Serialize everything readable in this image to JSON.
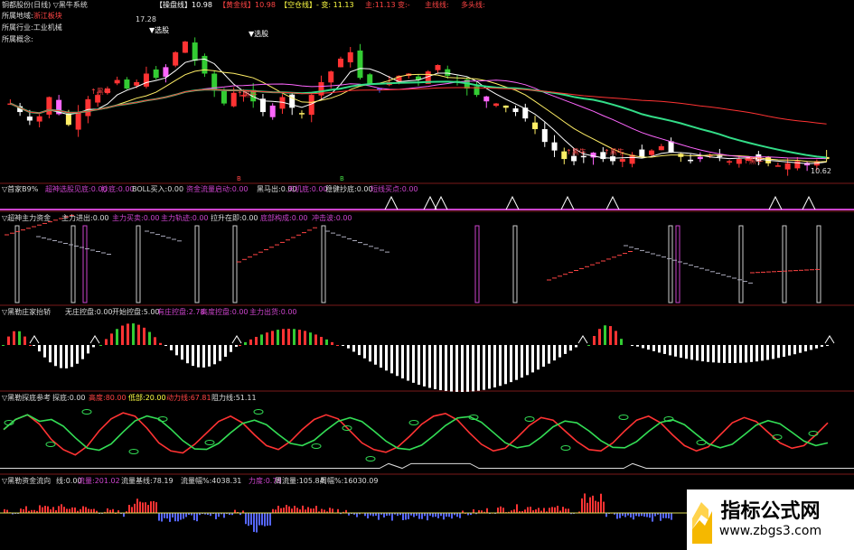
{
  "top_header": {
    "name": "铜都股份(日线) ▽黑牛系统",
    "items": [
      {
        "label": "【操盘线】",
        "value": "10.98",
        "color": "#ffffff"
      },
      {
        "label": "【黄金线】",
        "value": "10.98",
        "color": "#ff4444"
      },
      {
        "label": "【空仓线】",
        "value": "- 变: 11.13",
        "color": "#ffff44"
      },
      {
        "label": "主:",
        "value": "11.13",
        "color": "#ff4444"
      },
      {
        "label": "变:",
        "value": "-",
        "color": "#ff4444"
      },
      {
        "label": "主线线:",
        "value": "",
        "color": "#ff4444"
      },
      {
        "label": "多头线:",
        "value": "",
        "color": "#ff4444"
      }
    ]
  },
  "info_lines": [
    {
      "label": "所属地域:",
      "value": "浙江板块"
    },
    {
      "label": "所属行业:",
      "value": "工业机械"
    },
    {
      "label": "所属概念:",
      "value": ""
    }
  ],
  "main_annotations": {
    "peak_price": "17.28",
    "low_price": "10.62",
    "selection_labels": [
      "选股",
      "选股"
    ],
    "buy_labels": [
      "黑牛",
      "黑牛",
      "黑牛",
      "黑牛",
      "黑牛"
    ],
    "bottom_markers": [
      "B",
      "B"
    ]
  },
  "panels": [
    {
      "id": "panel2",
      "title": "▽首家B9%",
      "items": [
        {
          "label": "超神选股见底:",
          "value": "0.00",
          "color": "#cc44cc"
        },
        {
          "label": "抄底:",
          "value": "0.00",
          "color": "#cc44cc"
        },
        {
          "label": "BOLL买入:",
          "value": "0.00",
          "color": "#dddddd"
        },
        {
          "label": "资金流量启动:",
          "value": "0.00",
          "color": "#cc44cc"
        },
        {
          "label": "黑马出:",
          "value": "0.00",
          "color": "#dddddd"
        },
        {
          "label": "天机底:",
          "value": "0.00",
          "color": "#cc44cc"
        },
        {
          "label": "稳健抄底:",
          "value": "0.00",
          "color": "#dddddd"
        },
        {
          "label": "短线买点:",
          "value": "0.00",
          "color": "#cc44cc"
        }
      ]
    },
    {
      "id": "panel3",
      "title": "▽超神主力资金",
      "items": [
        {
          "label": "主力进出:",
          "value": "0.00",
          "color": "#dddddd"
        },
        {
          "label": "主力买卖:",
          "value": "0.00",
          "color": "#cc44cc"
        },
        {
          "label": "主力轨迹:",
          "value": "0.00",
          "color": "#cc44cc"
        },
        {
          "label": "拉升在即:",
          "value": "0.00",
          "color": "#dddddd"
        },
        {
          "label": "底部构成:",
          "value": "0.00",
          "color": "#cc44cc"
        },
        {
          "label": "冲击波:",
          "value": "0.00",
          "color": "#cc44cc"
        }
      ]
    },
    {
      "id": "panel4",
      "title": "▽黑勒庄家抬轿",
      "items": [
        {
          "label": "无庄控盘:",
          "value": "0.00",
          "color": "#dddddd"
        },
        {
          "label": "开始控盘:",
          "value": "5.00",
          "color": "#dddddd"
        },
        {
          "label": "有庄控盘:",
          "value": "2.78",
          "color": "#cc44cc"
        },
        {
          "label": "高度控盘:",
          "value": "0.00",
          "color": "#cc44cc"
        },
        {
          "label": "主力出货:",
          "value": "0.00",
          "color": "#cc44cc"
        }
      ]
    },
    {
      "id": "panel5",
      "title": "▽黑勒探底参考",
      "items": [
        {
          "label": "探底:",
          "value": "0.00",
          "color": "#dddddd"
        },
        {
          "label": "高度:",
          "value": "80.00",
          "color": "#ff4444"
        },
        {
          "label": "低部:",
          "value": "20.00",
          "color": "#ffff44"
        },
        {
          "label": "动力线:",
          "value": "67.81",
          "color": "#ff4444"
        },
        {
          "label": "阻力线:",
          "value": "51.11",
          "color": "#dddddd"
        }
      ]
    },
    {
      "id": "panel6",
      "title": "▽黑勒资金流向",
      "items": [
        {
          "label": "线:",
          "value": "0.00",
          "color": "#dddddd"
        },
        {
          "label": "流量:",
          "value": "201.02",
          "color": "#cc44cc"
        },
        {
          "label": "流量基线:",
          "value": "78.19",
          "color": "#dddddd"
        },
        {
          "label": "流量幅%:",
          "value": "4038.31",
          "color": "#dddddd"
        },
        {
          "label": "力度:",
          "value": "0.78",
          "color": "#cc44cc"
        },
        {
          "label": "周流量:",
          "value": "105.84",
          "color": "#dddddd"
        },
        {
          "label": "周幅%:",
          "value": "16030.09",
          "color": "#dddddd"
        }
      ]
    }
  ],
  "watermark": {
    "title": "指标公式网",
    "url": "www.zbgs3.com"
  },
  "chart_data": {
    "type": "line",
    "title": "",
    "price_range": [
      10.62,
      17.28
    ],
    "main_close_approx": [
      13.6,
      13.2,
      12.8,
      13.0,
      13.9,
      13.1,
      12.6,
      13.2,
      13.8,
      14.0,
      14.3,
      14.7,
      14.3,
      14.6,
      15.0,
      14.8,
      15.3,
      16.0,
      16.5,
      15.6,
      15.0,
      14.2,
      13.6,
      14.1,
      14.0,
      13.7,
      13.2,
      13.5,
      13.9,
      13.4,
      13.1,
      14.0,
      14.6,
      15.1,
      15.7,
      16.0,
      14.8,
      14.5,
      14.3,
      14.6,
      14.9,
      15.0,
      14.7,
      15.1,
      15.4,
      14.9,
      14.6,
      14.3,
      14.0,
      13.7,
      13.6,
      13.4,
      13.2,
      12.9,
      12.4,
      11.8,
      11.4,
      11.0,
      10.9,
      11.1,
      11.3,
      11.0,
      10.9,
      11.0,
      11.2,
      11.1,
      11.4,
      11.6,
      11.3,
      11.1,
      10.9,
      11.0,
      11.2,
      11.1,
      10.9,
      11.0,
      11.1,
      10.9,
      10.8,
      10.7,
      10.8,
      10.9,
      10.7,
      10.9,
      11.0
    ],
    "oscillator_k_approx": [
      60,
      75,
      82,
      68,
      45,
      30,
      22,
      35,
      58,
      76,
      85,
      80,
      62,
      40,
      28,
      25,
      38,
      55,
      72,
      80,
      70,
      52,
      36,
      30,
      42,
      60,
      75,
      82,
      76,
      58,
      40,
      30,
      26,
      34,
      50,
      68,
      80,
      84,
      74,
      55,
      38,
      28,
      32,
      48,
      66,
      78,
      74,
      58,
      42,
      30,
      28,
      40,
      58,
      74,
      80,
      70,
      52,
      36,
      28,
      34,
      52,
      70,
      78,
      72,
      56,
      40,
      32,
      36,
      52,
      70
    ]
  }
}
